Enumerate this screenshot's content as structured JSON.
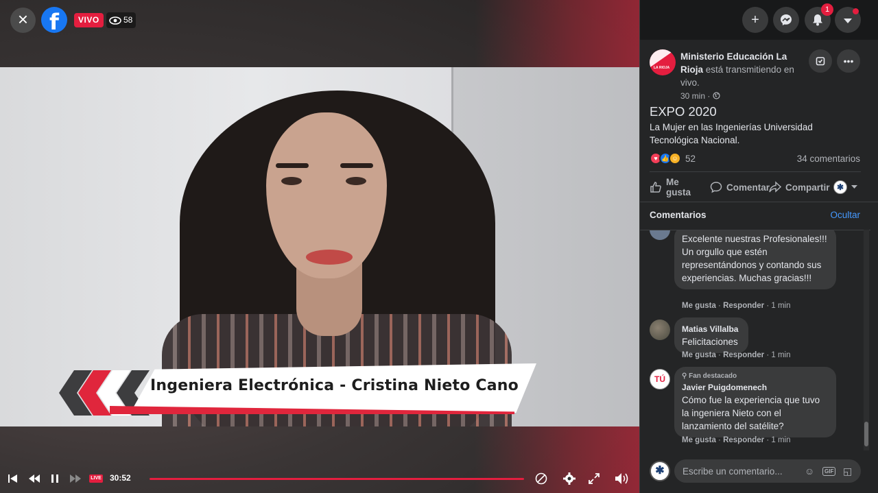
{
  "video": {
    "live_label": "VIVO",
    "viewer_count": "58",
    "lower_third": "Ingeniera Electrónica - Cristina Nieto Cano",
    "elapsed": "30:52",
    "live_mini": "LIVE",
    "progress": 1.0
  },
  "topbar": {
    "notification_count": "1"
  },
  "post": {
    "page_name": "Ministerio Educación La Rioja",
    "status_text": " está transmitiendo en vivo.",
    "avatar_text": "LA RIOJA",
    "time": "30 min · ",
    "title": "EXPO 2020",
    "description": "La Mujer en las Ingenierías Universidad Tecnológica Nacional.",
    "reaction_count": "52",
    "comment_count": "34 comentarios",
    "actions": {
      "like": "Me gusta",
      "comment": "Comentar",
      "share": "Compartir"
    }
  },
  "comments_section": {
    "header": "Comentarios",
    "hide": "Ocultar",
    "items": [
      {
        "text": "Excelente nuestras Profesionales!!! Un orgullo que estén representándonos y contando sus experiencias. Muchas gracias!!!",
        "like": "Me gusta",
        "reply": "Responder",
        "time": "1 min"
      },
      {
        "author": "Matias Villalba",
        "text": "Felicitaciones",
        "like": "Me gusta",
        "reply": "Responder",
        "time": "1 min"
      },
      {
        "badge": "Fan destacado",
        "author": "Javier Puigdomenech",
        "text": "Cómo fue la experiencia que tuvo la ingeniera Nieto con el lanzamiento del satélite?",
        "avatar_text": "TÚ",
        "like": "Me gusta",
        "reply": "Responder",
        "time": "1 min"
      }
    ]
  },
  "composer": {
    "placeholder": "Escribe un comentario...",
    "gif_label": "GIF"
  },
  "icons": {
    "close": "close-icon",
    "eye": "eye-icon",
    "plus": "plus-icon",
    "messenger": "messenger-icon",
    "bell": "bell-icon",
    "caret": "caret-down-icon"
  },
  "colors": {
    "brand_blue": "#1877f2",
    "live_red": "#e41e3f",
    "panel_bg": "#242526",
    "link_blue": "#4599ff"
  }
}
